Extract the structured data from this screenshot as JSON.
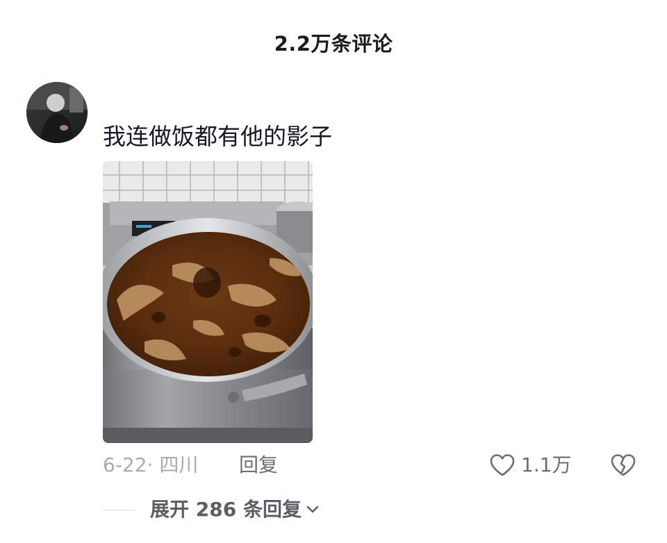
{
  "header": {
    "title": "2.2万条评论"
  },
  "comment": {
    "avatar_icon": "user-avatar",
    "text": "我连做饭都有他的影子",
    "image_icon": "cooking-pot-photo",
    "date_location": "6-22· 四川",
    "reply_label": "回复",
    "like_icon": "heart-outline-icon",
    "like_count": "1.1万",
    "dislike_icon": "broken-heart-icon",
    "expand_label": "展开 286 条回复",
    "expand_icon": "chevron-down-icon"
  }
}
